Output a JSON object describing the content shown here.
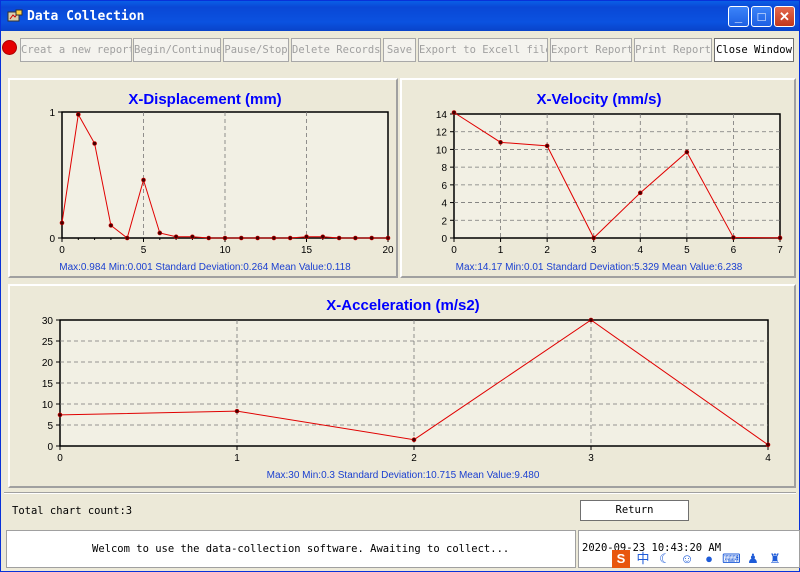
{
  "window": {
    "title": "Data Collection",
    "colors": {
      "title_bar": "#0a48d6",
      "chart_title": "#0000ff",
      "line": "#e00000",
      "stats": "#1a3fd0"
    }
  },
  "toolbar": {
    "record_indicator": "record-icon",
    "buttons": [
      {
        "label": "Creat a new report",
        "enabled": false
      },
      {
        "label": "Begin/Continue",
        "enabled": false
      },
      {
        "label": "Pause/Stop",
        "enabled": false
      },
      {
        "label": "Delete Records",
        "enabled": false
      },
      {
        "label": "Save",
        "enabled": false
      },
      {
        "label": "Export to Excell file",
        "enabled": false
      },
      {
        "label": "Export Report",
        "enabled": false
      },
      {
        "label": "Print Report",
        "enabled": false
      },
      {
        "label": "Close Window",
        "enabled": true
      }
    ]
  },
  "chart_data": [
    {
      "type": "line",
      "title": "X-Displacement (mm)",
      "x": [
        0,
        1,
        2,
        3,
        4,
        5,
        6,
        7,
        8,
        9,
        10,
        11,
        12,
        13,
        14,
        15,
        16,
        17,
        18,
        19,
        20
      ],
      "series": [
        {
          "values": [
            0.12,
            0.98,
            0.75,
            0.1,
            0.0,
            0.46,
            0.04,
            0.01,
            0.01,
            0.0,
            0.0,
            0.0,
            0.0,
            0.0,
            0.0,
            0.01,
            0.01,
            0.0,
            0.0,
            0.0,
            0.0
          ]
        }
      ],
      "xlim": [
        0,
        20
      ],
      "ylim": [
        0,
        1
      ],
      "xticks": [
        "0",
        "5",
        "10",
        "15",
        "20"
      ],
      "yticks": [
        "0",
        "1"
      ],
      "grid": true,
      "stats": "Max:0.984  Min:0.001 Standard Deviation:0.264 Mean Value:0.118"
    },
    {
      "type": "line",
      "title": "X-Velocity (mm/s)",
      "x": [
        0,
        1,
        2,
        3,
        4,
        5,
        6,
        7
      ],
      "series": [
        {
          "values": [
            14.17,
            10.8,
            10.4,
            0.01,
            5.1,
            9.7,
            0.05,
            0.02
          ]
        }
      ],
      "xlim": [
        0,
        7
      ],
      "ylim": [
        0,
        14
      ],
      "xticks": [
        "0",
        "1",
        "2",
        "3",
        "4",
        "5",
        "6",
        "7"
      ],
      "yticks": [
        "0",
        "2",
        "4",
        "6",
        "8",
        "10",
        "12",
        "14"
      ],
      "grid": true,
      "stats": "Max:14.17  Min:0.01 Standard Deviation:5.329 Mean Value:6.238"
    },
    {
      "type": "line",
      "title": "X-Acceleration (m/s2)",
      "x": [
        0,
        1,
        2,
        3,
        4
      ],
      "series": [
        {
          "values": [
            7.4,
            8.3,
            1.5,
            30,
            0.3
          ]
        }
      ],
      "xlim": [
        0,
        4
      ],
      "ylim": [
        0,
        30
      ],
      "xticks": [
        "0",
        "1",
        "2",
        "3",
        "4"
      ],
      "yticks": [
        "0",
        "5",
        "10",
        "15",
        "20",
        "25",
        "30"
      ],
      "grid": true,
      "stats": "Max:30  Min:0.3 Standard Deviation:10.715 Mean Value:9.480"
    }
  ],
  "footer": {
    "count_text": "Total chart count:3",
    "return_label": "Return",
    "status_message": "Welcom to use the data-collection software. Awaiting to collect...",
    "datetime": "2020-09-23 10:43:20 AM",
    "tray_icons": [
      "ime-s-icon",
      "chinese-icon",
      "moon-icon",
      "smiley-icon",
      "mic-icon",
      "keyboard-icon",
      "user-icon",
      "shirt-icon"
    ],
    "tray_glyphs": [
      "S",
      "中",
      "☾",
      "☺",
      "●",
      "⌨",
      "♟",
      "♜"
    ]
  }
}
